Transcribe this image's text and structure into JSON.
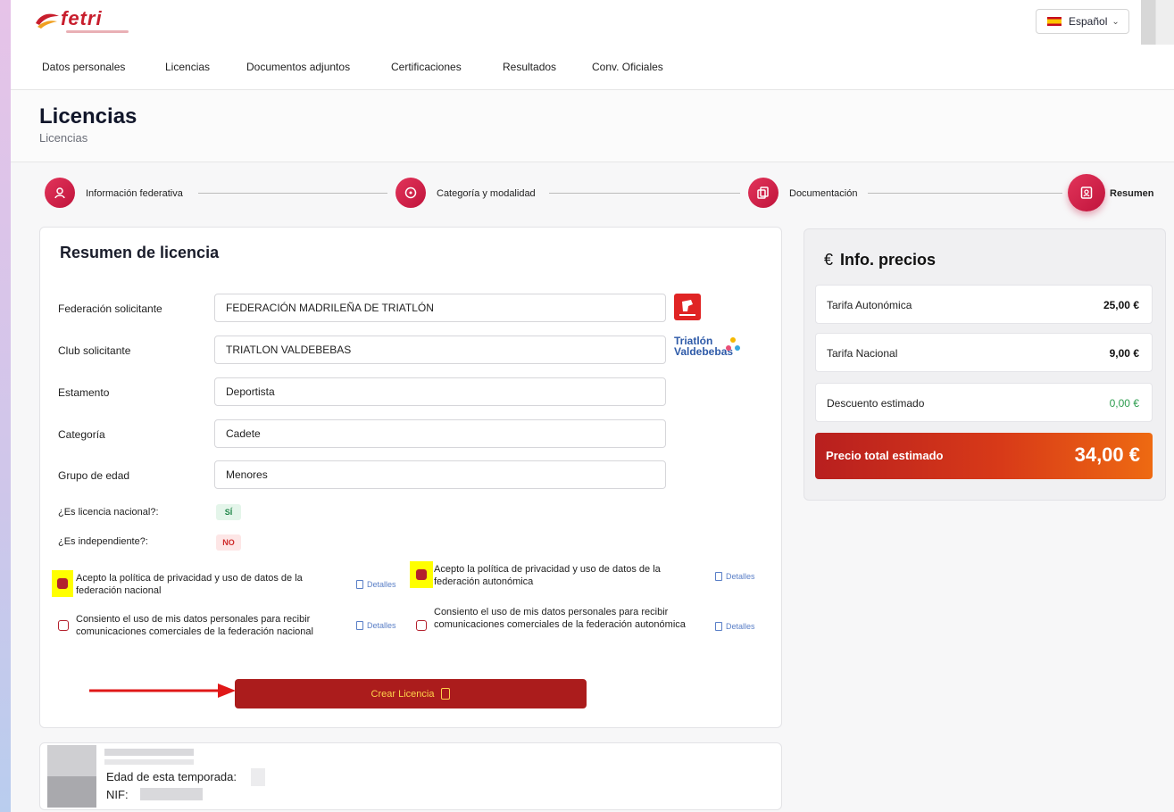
{
  "header": {
    "logo_text": "fetri",
    "language": "Español"
  },
  "nav": {
    "items": [
      "Datos personales",
      "Licencias",
      "Documentos adjuntos",
      "Certificaciones",
      "Resultados",
      "Conv. Oficiales"
    ]
  },
  "page": {
    "title": "Licencias",
    "breadcrumb": "Licencias"
  },
  "steps": [
    {
      "label": "Información federativa",
      "icon": "user-pin-icon"
    },
    {
      "label": "Categoría y modalidad",
      "icon": "category-icon"
    },
    {
      "label": "Documentación",
      "icon": "documents-icon"
    },
    {
      "label": "Resumen",
      "icon": "summary-icon",
      "active": true
    }
  ],
  "summary": {
    "title": "Resumen de licencia",
    "fields": [
      {
        "label": "Federación solicitante",
        "value": "FEDERACIÓN MADRILEÑA DE TRIATLÓN"
      },
      {
        "label": "Club solicitante",
        "value": "TRIATLON VALDEBEBAS"
      },
      {
        "label": "Estamento",
        "value": "Deportista"
      },
      {
        "label": "Categoría",
        "value": "Cadete"
      },
      {
        "label": "Grupo de edad",
        "value": "Menores"
      }
    ],
    "club_logo_text": "Triatlón\nValdebebas",
    "national_label": "¿Es licencia nacional?:",
    "national_value": "SÍ",
    "independent_label": "¿Es independiente?:",
    "independent_value": "NO",
    "consents": [
      {
        "text": "Acepto la política de privacidad y uso de datos de la federación nacional",
        "checked": true
      },
      {
        "text": "Acepto la política de privacidad y uso de datos de la federación autonómica",
        "checked": true
      },
      {
        "text": "Consiento el uso de mis datos personales para recibir comunicaciones comerciales de la federación nacional",
        "checked": false
      },
      {
        "text": "Consiento el uso de mis datos personales para recibir comunicaciones comerciales de la federación autonómica",
        "checked": false
      }
    ],
    "details_label": "Detalles",
    "create_button": "Crear Licencia"
  },
  "prices": {
    "title": "Info. precios",
    "currency_symbol": "€",
    "rows": [
      {
        "label": "Tarifa Autonómica",
        "value": "25,00 €"
      },
      {
        "label": "Tarifa Nacional",
        "value": "9,00 €"
      },
      {
        "label": "Descuento estimado",
        "value": "0,00 €"
      }
    ],
    "total_label": "Precio total estimado",
    "total_value": "34,00 €"
  },
  "user": {
    "age_label": "Edad de esta temporada:",
    "nif_label": "NIF:"
  },
  "colors": {
    "accent": "#ab1c1c",
    "step": "#d0234a",
    "discount": "#2e9d4f"
  }
}
